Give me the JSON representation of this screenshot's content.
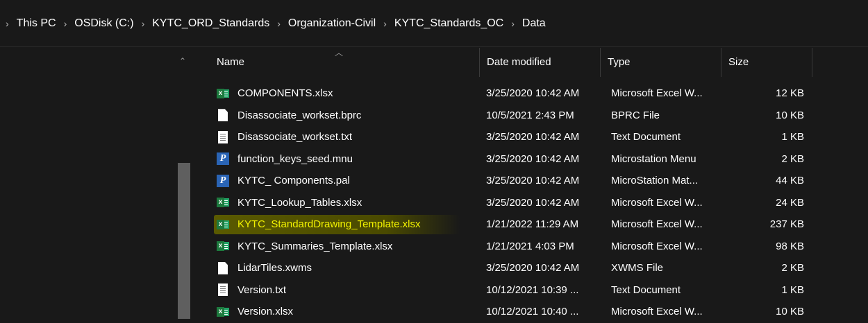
{
  "breadcrumb": {
    "items": [
      "This PC",
      "OSDisk (C:)",
      "KYTC_ORD_Standards",
      "Organization-Civil",
      "KYTC_Standards_OC",
      "Data"
    ],
    "separator": "›"
  },
  "columns": {
    "name": "Name",
    "date": "Date modified",
    "type": "Type",
    "size": "Size"
  },
  "files": [
    {
      "icon": "excel-icon",
      "name": "COMPONENTS.xlsx",
      "date": "3/25/2020 10:42 AM",
      "type": "Microsoft Excel W...",
      "size": "12 KB"
    },
    {
      "icon": "file-icon",
      "name": "Disassociate_workset.bprc",
      "date": "10/5/2021 2:43 PM",
      "type": "BPRC File",
      "size": "10 KB"
    },
    {
      "icon": "text-file-icon",
      "name": "Disassociate_workset.txt",
      "date": "3/25/2020 10:42 AM",
      "type": "Text Document",
      "size": "1 KB"
    },
    {
      "icon": "microstation-icon",
      "name": "function_keys_seed.mnu",
      "date": "3/25/2020 10:42 AM",
      "type": "Microstation Menu",
      "size": "2 KB"
    },
    {
      "icon": "microstation-icon",
      "name": "KYTC_ Components.pal",
      "date": "3/25/2020 10:42 AM",
      "type": "MicroStation Mat...",
      "size": "44 KB"
    },
    {
      "icon": "excel-icon",
      "name": "KYTC_Lookup_Tables.xlsx",
      "date": "3/25/2020 10:42 AM",
      "type": "Microsoft Excel W...",
      "size": "24 KB"
    },
    {
      "icon": "excel-icon",
      "name": "KYTC_StandardDrawing_Template.xlsx",
      "date": "1/21/2022 11:29 AM",
      "type": "Microsoft Excel W...",
      "size": "237 KB",
      "highlighted": true
    },
    {
      "icon": "excel-icon",
      "name": "KYTC_Summaries_Template.xlsx",
      "date": "1/21/2021 4:03 PM",
      "type": "Microsoft Excel W...",
      "size": "98 KB"
    },
    {
      "icon": "file-icon",
      "name": "LidarTiles.xwms",
      "date": "3/25/2020 10:42 AM",
      "type": "XWMS File",
      "size": "2 KB"
    },
    {
      "icon": "text-file-icon",
      "name": "Version.txt",
      "date": "10/12/2021 10:39 ...",
      "type": "Text Document",
      "size": "1 KB"
    },
    {
      "icon": "excel-icon",
      "name": "Version.xlsx",
      "date": "10/12/2021 10:40 ...",
      "type": "Microsoft Excel W...",
      "size": "10 KB"
    }
  ],
  "colors": {
    "background": "#191919",
    "highlight": "#5a5a00",
    "highlight_text": "#f2f200",
    "excel_green": "#1d7a3e",
    "microstation_blue": "#2a64b5"
  }
}
